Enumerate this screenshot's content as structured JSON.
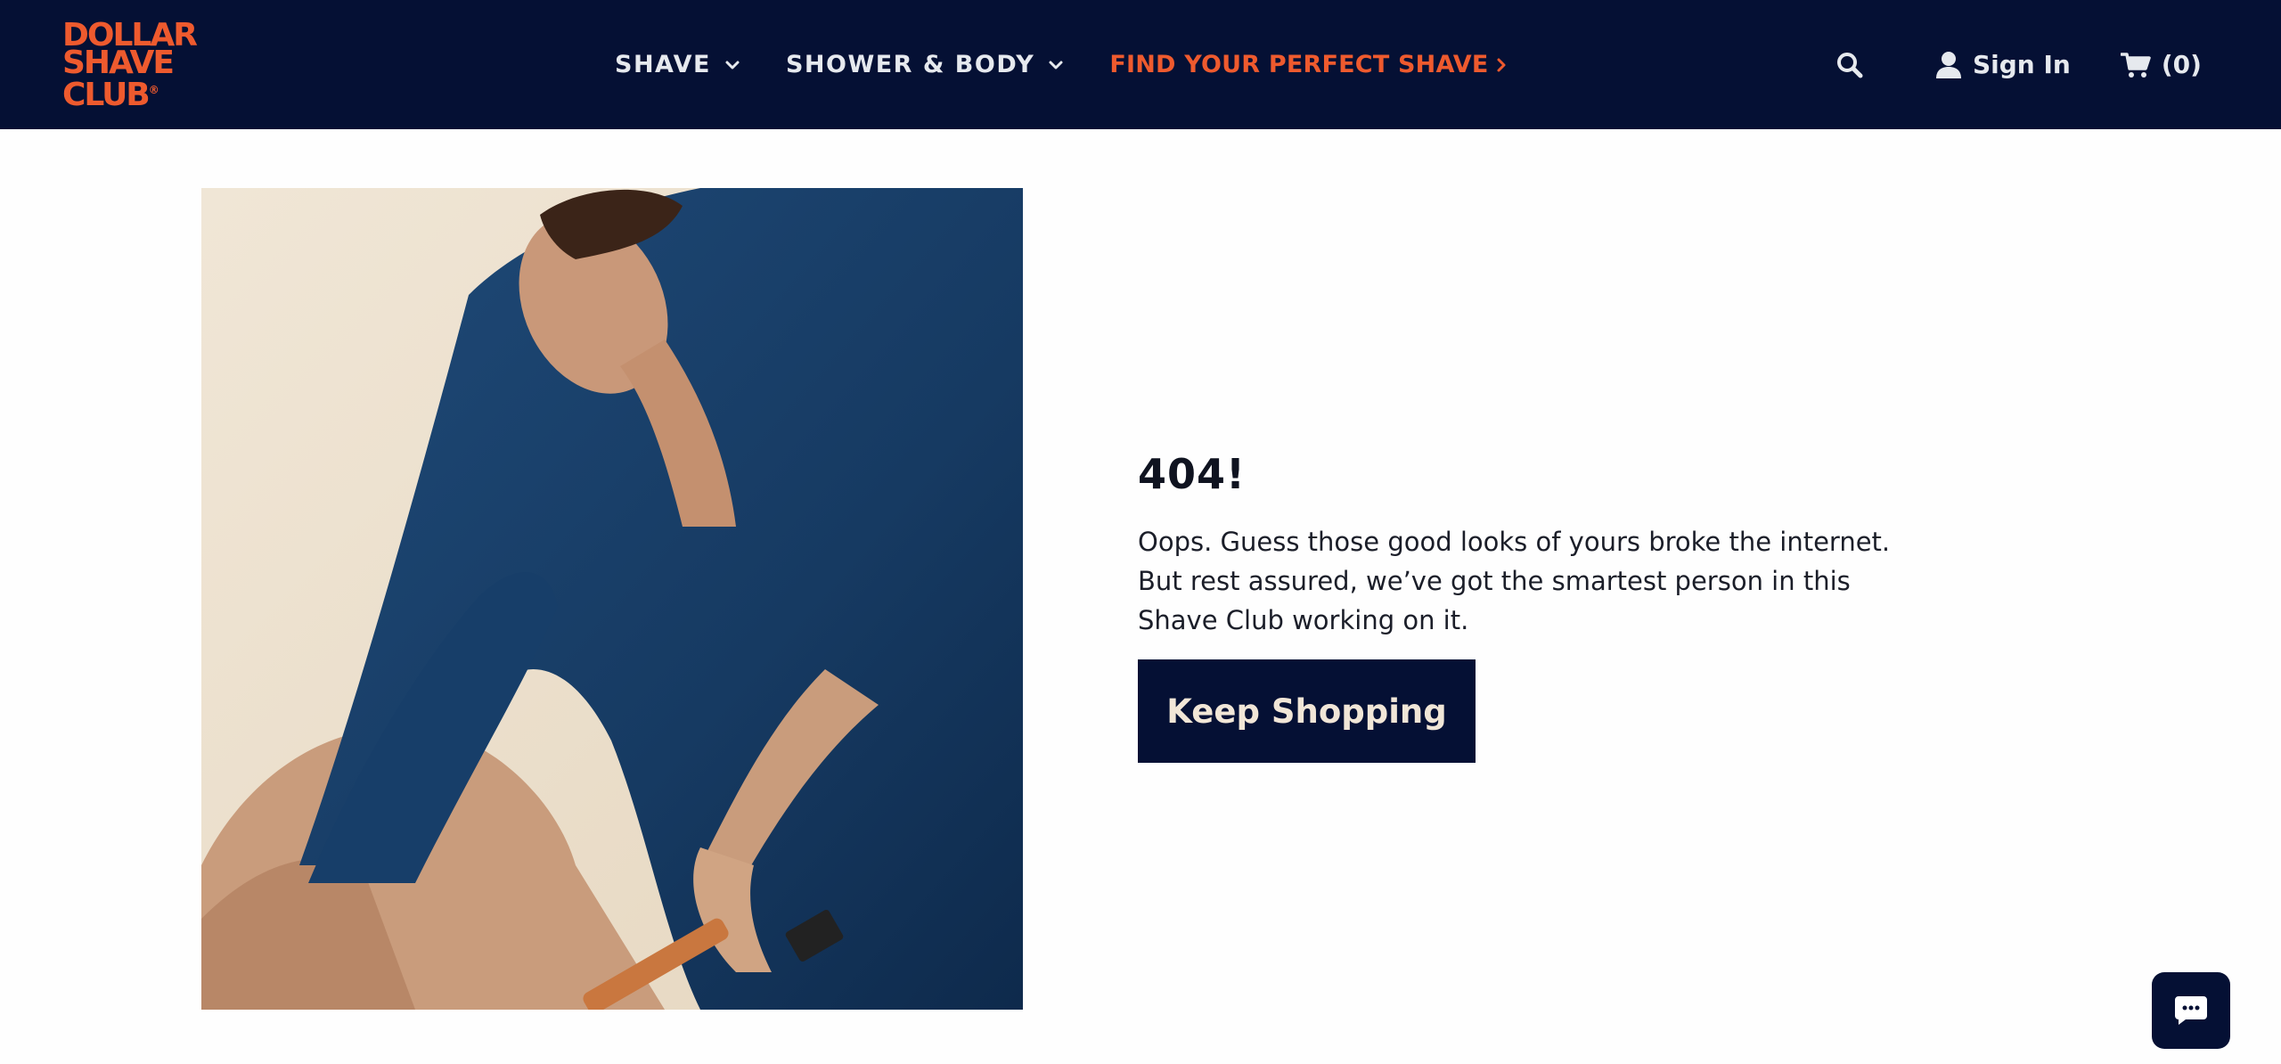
{
  "brand": {
    "logo_lines": [
      "DOLLAR",
      "SHAVE",
      "CLUB"
    ],
    "logo_mark": "®",
    "accent_color": "#ee5a2e",
    "nav_bg_color": "#051034"
  },
  "nav": {
    "items": [
      {
        "label": "SHAVE",
        "icon": "chevron-down-icon"
      },
      {
        "label": "SHOWER & BODY",
        "icon": "chevron-down-icon"
      },
      {
        "label": "FIND YOUR PERFECT SHAVE",
        "icon": "chevron-right-icon"
      }
    ]
  },
  "utilities": {
    "search_icon": "search-icon",
    "signin_label": "Sign In",
    "signin_icon": "user-icon",
    "cart_label": "(0)",
    "cart_icon": "cart-icon"
  },
  "main": {
    "heading": "404!",
    "body": "Oops. Guess those good looks of yours broke the internet. But rest assured, we’ve got the smartest person in this Shave Club working on it.",
    "cta_label": "Keep Shopping"
  },
  "chat": {
    "icon": "chat-bubble-icon"
  }
}
